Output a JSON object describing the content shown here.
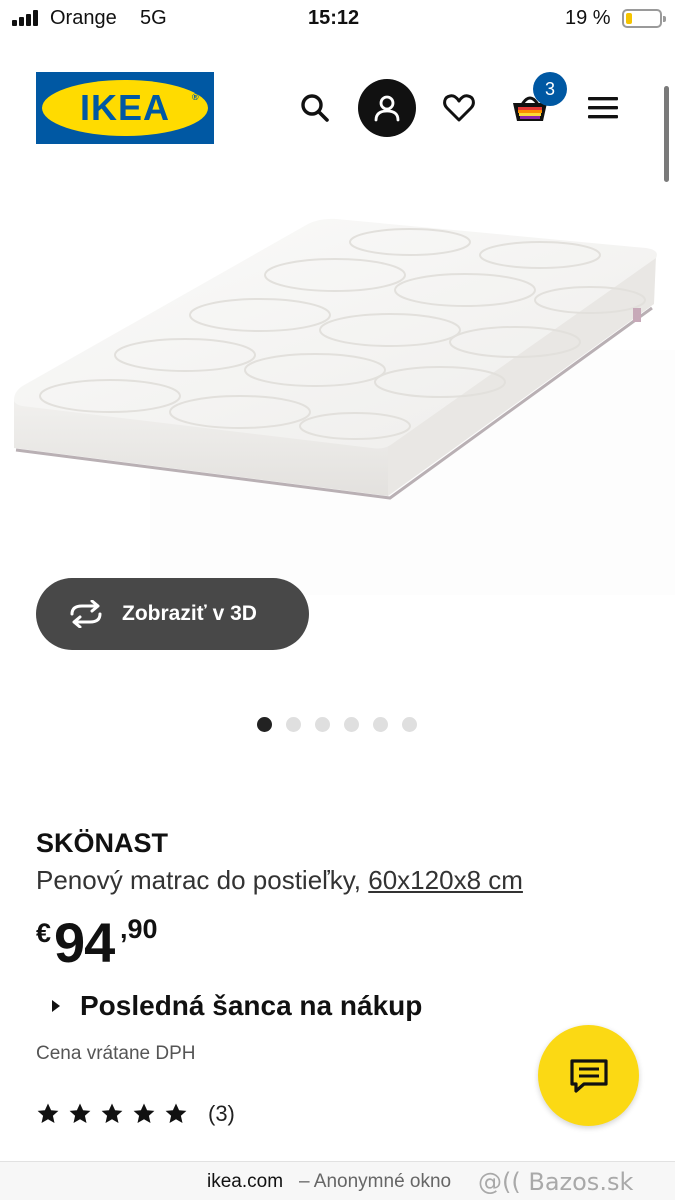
{
  "status_bar": {
    "carrier": "Orange",
    "network": "5G",
    "time": "15:12",
    "battery_percent": "19 %",
    "battery_level": 0.19,
    "battery_color": "#f5c400"
  },
  "header": {
    "logo_text": "IKEA",
    "logo_colors": {
      "blue": "#0058a3",
      "yellow": "#ffdb00"
    },
    "icons": [
      "search-icon",
      "account-icon",
      "heart-icon",
      "basket-icon",
      "menu-icon"
    ],
    "cart_count": "3"
  },
  "gallery": {
    "view3d_label": "Zobraziť v 3D",
    "image_count": 6,
    "active_index": 0
  },
  "product": {
    "name": "SKÖNAST",
    "description": "Penový matrac do postieľky,",
    "size": "60x120x8 cm",
    "price_currency": "€",
    "price_integer": "94",
    "price_decimal": ",90",
    "last_chance": "Posledná šanca na nákup",
    "vat_note": "Cena vrátane DPH",
    "rating_stars": 5,
    "rating_count": "(3)"
  },
  "chat": {
    "icon": "chat-icon",
    "color": "#fbd914"
  },
  "browser_bar": {
    "domain": "ikea.com",
    "mode": "– Anonymné okno",
    "watermark": "@(( Bazos.sk"
  }
}
